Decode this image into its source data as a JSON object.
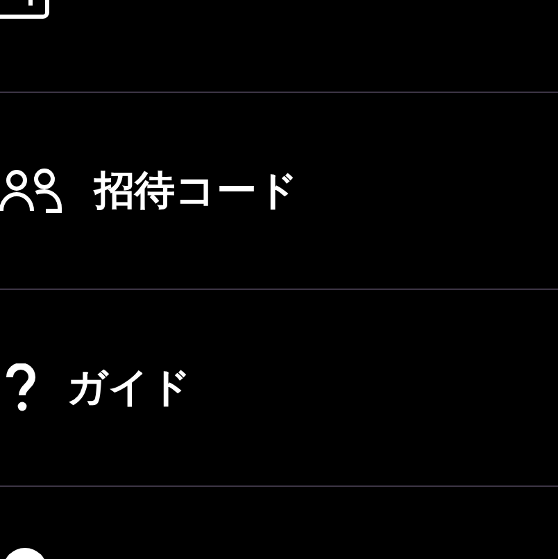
{
  "menu_items": [
    {
      "kind": "coupon"
    },
    {
      "kind": "invite",
      "label": "招待コード"
    },
    {
      "kind": "guide",
      "label": "ガイド"
    },
    {
      "kind": "info"
    }
  ]
}
